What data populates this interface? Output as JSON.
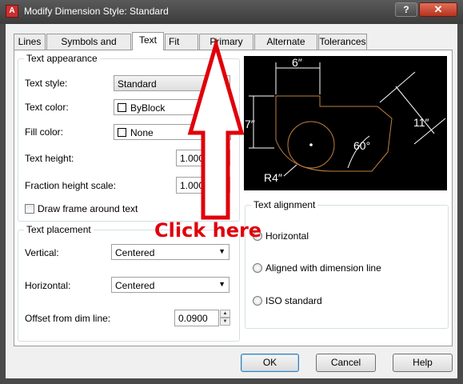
{
  "window": {
    "title": "Modify Dimension Style: Standard",
    "help_label": "?",
    "close_label": "✕"
  },
  "tabs": [
    {
      "label": "Lines"
    },
    {
      "label": "Symbols and Arrows"
    },
    {
      "label": "Text"
    },
    {
      "label": "Fit"
    },
    {
      "label": "Primary Units"
    },
    {
      "label": "Alternate Units"
    },
    {
      "label": "Tolerances"
    }
  ],
  "active_tab": "Text",
  "text_appearance": {
    "title": "Text appearance",
    "text_style_label": "Text style:",
    "text_style_value": "Standard",
    "browse_label": "...",
    "text_color_label": "Text color:",
    "text_color_value": "ByBlock",
    "fill_color_label": "Fill color:",
    "fill_color_value": "None",
    "text_height_label": "Text height:",
    "text_height_value": "1.0000",
    "fraction_label": "Fraction height scale:",
    "fraction_value": "1.0000",
    "frame_label": "Draw frame around text",
    "frame_checked": false
  },
  "text_placement": {
    "title": "Text placement",
    "vertical_label": "Vertical:",
    "vertical_value": "Centered",
    "horizontal_label": "Horizontal:",
    "horizontal_value": "Centered",
    "offset_label": "Offset from dim line:",
    "offset_value": "0.0900"
  },
  "text_alignment": {
    "title": "Text alignment",
    "options": [
      {
        "label": "Horizontal",
        "selected": false
      },
      {
        "label": "Aligned with dimension line",
        "selected": false
      },
      {
        "label": "ISO standard",
        "selected": false
      }
    ]
  },
  "preview": {
    "dim_top": "6″",
    "dim_left": "7″",
    "dim_right": "11″",
    "dim_angle": "60°",
    "dim_radius": "R4″",
    "colors": {
      "background": "#000000",
      "geometry": "#c08040",
      "dimensions": "#ffffff"
    }
  },
  "buttons": {
    "ok": "OK",
    "cancel": "Cancel",
    "help": "Help"
  },
  "annotation": {
    "text": "Click here",
    "color": "#e0000a"
  }
}
